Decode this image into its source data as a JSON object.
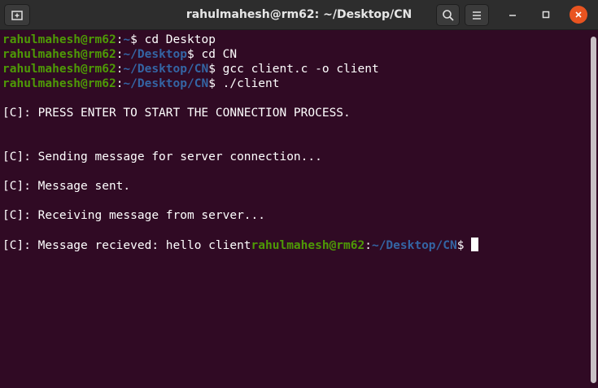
{
  "window": {
    "title": "rahulmahesh@rm62: ~/Desktop/CN"
  },
  "toolbar": {
    "new_tab_icon": "new-tab-icon",
    "search_icon": "search-icon",
    "menu_icon": "hamburger-menu-icon",
    "minimize_icon": "minimize-icon",
    "maximize_icon": "maximize-icon",
    "close_icon": "close-icon"
  },
  "colors": {
    "terminal_bg": "#300a24",
    "user_host": "#4e9a06",
    "path": "#3465a4",
    "text": "#ffffff",
    "close_button": "#e95420"
  },
  "terminal": {
    "prompt1": {
      "user": "rahulmahesh@rm62",
      "colon": ":",
      "path": "~",
      "dollar": "$",
      "cmd": " cd Desktop"
    },
    "prompt2": {
      "user": "rahulmahesh@rm62",
      "colon": ":",
      "path": "~/Desktop",
      "dollar": "$",
      "cmd": " cd CN"
    },
    "prompt3": {
      "user": "rahulmahesh@rm62",
      "colon": ":",
      "path": "~/Desktop/CN",
      "dollar": "$",
      "cmd": " gcc client.c -o client"
    },
    "prompt4": {
      "user": "rahulmahesh@rm62",
      "colon": ":",
      "path": "~/Desktop/CN",
      "dollar": "$",
      "cmd": " ./client"
    },
    "out1": "[C]: PRESS ENTER TO START THE CONNECTION PROCESS.",
    "out2": "[C]: Sending message for server connection...",
    "out3": "[C]: Message sent.",
    "out4": "[C]: Receiving message from server...",
    "out5": "[C]: Message recieved: hello client",
    "prompt5": {
      "user": "rahulmahesh@rm62",
      "colon": ":",
      "path": "~/Desktop/CN",
      "dollar": "$",
      "cmd": " "
    }
  }
}
